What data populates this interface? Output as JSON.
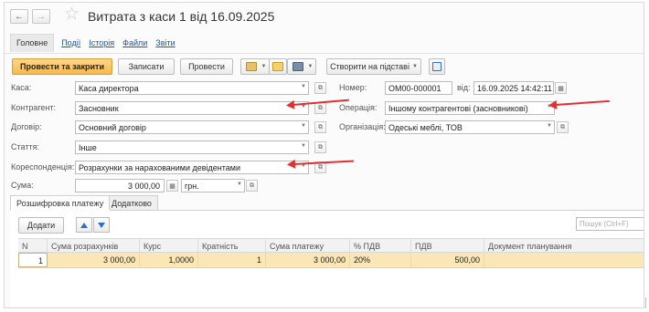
{
  "window": {
    "title": "Витрата з каси 1 від 16.09.2025"
  },
  "nav": {
    "back": "←",
    "forward": "→"
  },
  "menu": {
    "items": [
      "Головне",
      "Події",
      "Історія",
      "Файли",
      "Звіти"
    ]
  },
  "toolbar": {
    "post_close": "Провести та закрити",
    "save": "Записати",
    "post": "Провести",
    "create_based": "Створити на підставі"
  },
  "form": {
    "cashbox_label": "Каса:",
    "cashbox_value": "Каса директора",
    "counterparty_label": "Контрагент:",
    "counterparty_value": "Засновник",
    "contract_label": "Договір:",
    "contract_value": "Основний договір",
    "article_label": "Стаття:",
    "article_value": "Інше",
    "correspondence_label": "Кореспонденція:",
    "correspondence_value": "Розрахунки за нарахованими девідентами",
    "sum_label": "Сума:",
    "sum_value": "3 000,00",
    "currency_value": "грн.",
    "number_label": "Номер:",
    "number_value": "ОМ00-000001",
    "date_label": "від:",
    "date_value": "16.09.2025 14:42:11",
    "operation_label": "Операція:",
    "operation_value": "Іншому контрагентові (засновникові)",
    "organization_label": "Організація:",
    "organization_value": "Одеські меблі, ТОВ"
  },
  "tabs": [
    "Розшифровка платежу",
    "Додатково"
  ],
  "table_toolbar": {
    "add": "Додати",
    "search_placeholder": "Пошук (Ctrl+F)"
  },
  "table": {
    "columns": [
      "N",
      "Сума розрахунків",
      "Курс",
      "Кратність",
      "Сума платежу",
      "% ПДВ",
      "ПДВ",
      "Документ планування"
    ],
    "rows": [
      [
        "1",
        "3 000,00",
        "1,0000",
        "1",
        "3 000,00",
        "20%",
        "500,00",
        ""
      ]
    ]
  },
  "colors": {
    "primary_button": "#f6b84a",
    "link": "#1a57b0",
    "annotation_arrow": "#e03030",
    "selected_row": "#fbe6b6"
  },
  "icons": [
    "back-arrow-icon",
    "forward-arrow-icon",
    "star-icon",
    "calendar-icon",
    "calculator-icon",
    "open-icon",
    "dropdown-icon",
    "printer-icon",
    "email-icon",
    "document-icon",
    "move-up-icon",
    "move-down-icon",
    "table-structure-icon"
  ]
}
